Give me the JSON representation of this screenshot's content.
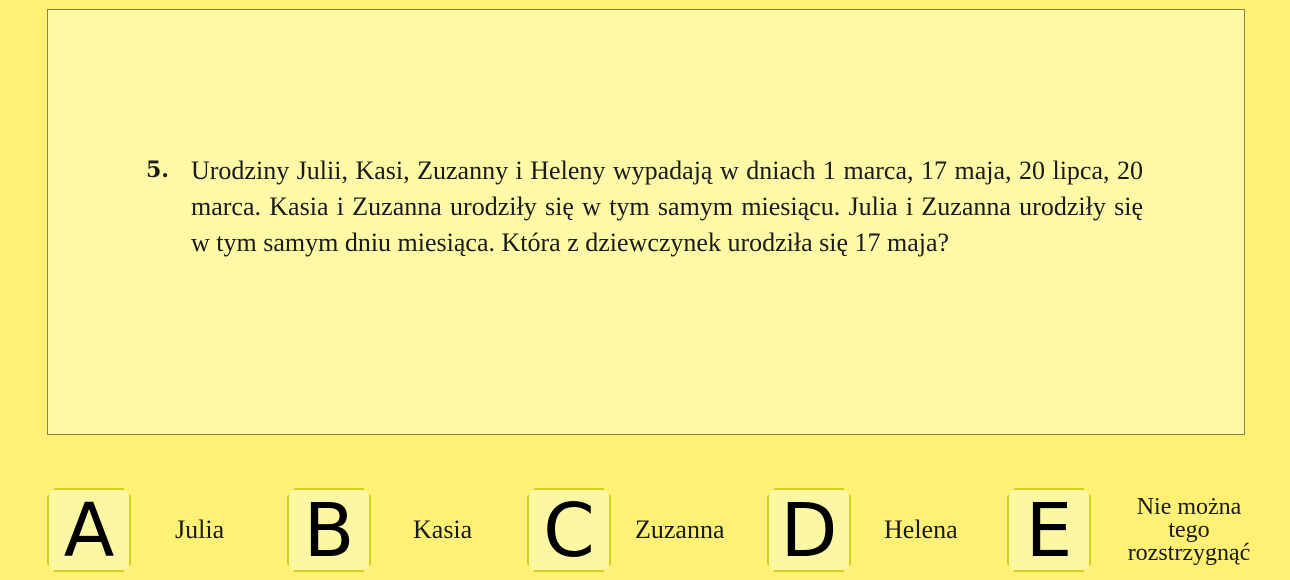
{
  "question": {
    "number": "5.",
    "text": "Urodziny Julii, Kasi, Zuzanny i Heleny wypadają w dniach 1 marca, 17 maja, 20 lipca, 20 marca. Kasia i Zuzanna urodziły się w tym samym miesiącu. Julia i Zuzanna urodziły się w tym samym dniu miesiąca. Która z dziewczynek urodziła się 17 maja?"
  },
  "answers": [
    {
      "letter": "A",
      "label": "Julia"
    },
    {
      "letter": "B",
      "label": "Kasia"
    },
    {
      "letter": "C",
      "label": "Zuzanna"
    },
    {
      "letter": "D",
      "label": "Helena"
    },
    {
      "letter": "E",
      "label_lines": [
        "Nie można",
        "tego",
        "rozstrzygnąć"
      ]
    }
  ],
  "colors": {
    "page_background": "#fef176",
    "question_background": "#fdf9a6",
    "option_border": "#d4cf1a"
  }
}
